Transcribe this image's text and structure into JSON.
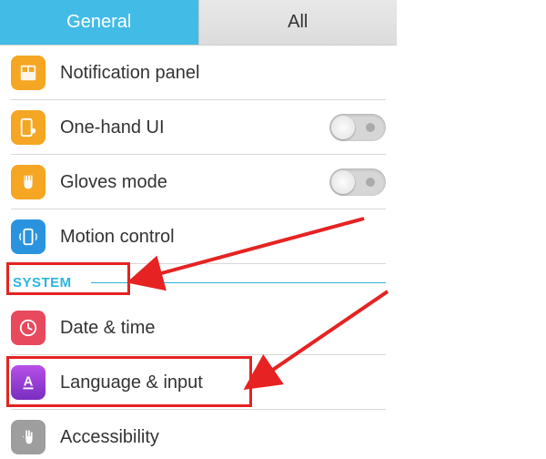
{
  "tabs": {
    "general": "General",
    "all": "All"
  },
  "items": {
    "notification_panel": "Notification panel",
    "one_hand_ui": "One-hand UI",
    "gloves_mode": "Gloves mode",
    "motion_control": "Motion control",
    "date_time": "Date & time",
    "language_input": "Language & input",
    "accessibility": "Accessibility"
  },
  "sections": {
    "system": "SYSTEM"
  },
  "colors": {
    "accent": "#42bce6",
    "highlight": "#e62222",
    "icon_orange": "#f5a623",
    "icon_blue": "#2a93e0",
    "icon_red": "#e8495c",
    "icon_purple": "#9a3fd9",
    "icon_gray": "#9e9e9e"
  }
}
